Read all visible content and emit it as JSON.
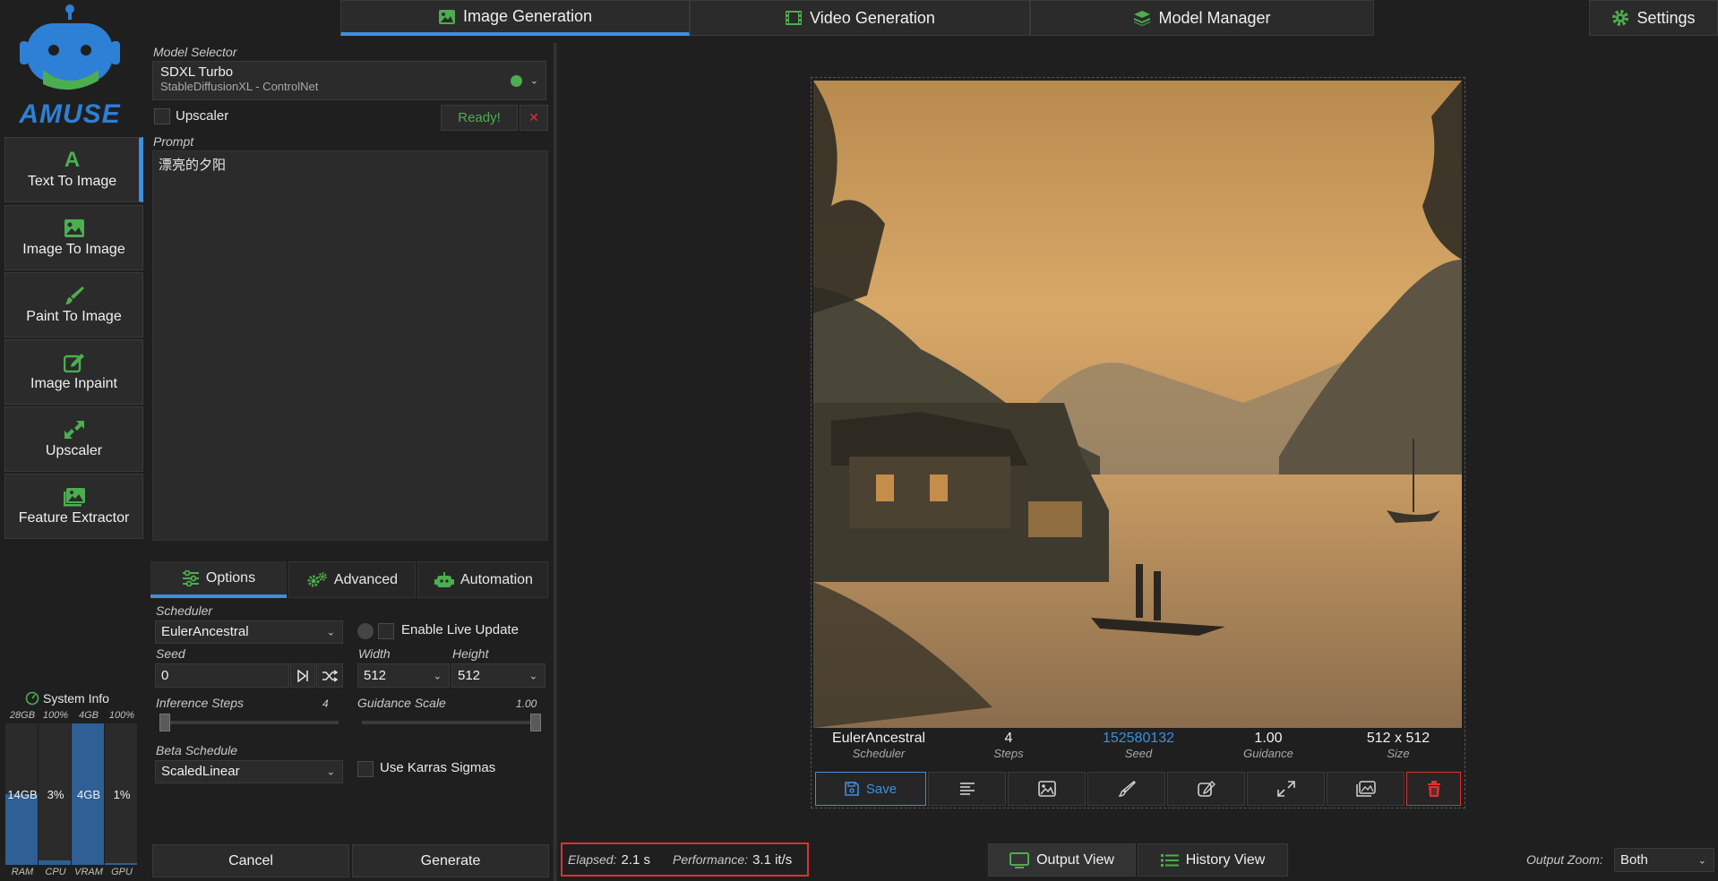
{
  "app": {
    "logo_text": "AMUSE"
  },
  "top_tabs": [
    {
      "label": "Image Generation",
      "icon": "image-icon",
      "active": true
    },
    {
      "label": "Video Generation",
      "icon": "film-icon",
      "active": false
    },
    {
      "label": "Model Manager",
      "icon": "layers-icon",
      "active": false
    }
  ],
  "settings_label": "Settings",
  "sidebar": {
    "items": [
      {
        "label": "Text To Image",
        "icon": "text-a-icon",
        "active": true
      },
      {
        "label": "Image To Image",
        "icon": "image-icon",
        "active": false
      },
      {
        "label": "Paint To Image",
        "icon": "brush-icon",
        "active": false
      },
      {
        "label": "Image Inpaint",
        "icon": "edit-icon",
        "active": false
      },
      {
        "label": "Upscaler",
        "icon": "expand-icon",
        "active": false
      },
      {
        "label": "Feature Extractor",
        "icon": "gallery-icon",
        "active": false
      }
    ],
    "system_info": {
      "title": "System Info",
      "meters": [
        {
          "top": "28GB",
          "mid": "14GB",
          "bottom": "RAM",
          "fill": 0.5
        },
        {
          "top": "100%",
          "mid": "3%",
          "bottom": "CPU",
          "fill": 0.03
        },
        {
          "top": "4GB",
          "mid": "4GB",
          "bottom": "VRAM",
          "fill": 1.0
        },
        {
          "top": "100%",
          "mid": "1%",
          "bottom": "GPU",
          "fill": 0.01
        }
      ]
    }
  },
  "model_selector": {
    "label": "Model Selector",
    "name": "SDXL Turbo",
    "sub": "StableDiffusionXL - ControlNet",
    "status_color": "#4cae4f"
  },
  "upscaler": {
    "label": "Upscaler",
    "ready": "Ready!",
    "close": "✕"
  },
  "prompt": {
    "label": "Prompt",
    "value": "漂亮的夕阳"
  },
  "option_tabs": [
    {
      "label": "Options",
      "active": true
    },
    {
      "label": "Advanced",
      "active": false
    },
    {
      "label": "Automation",
      "active": false
    }
  ],
  "options": {
    "scheduler_label": "Scheduler",
    "scheduler_value": "EulerAncestral",
    "live_update_label": "Enable Live Update",
    "seed_label": "Seed",
    "seed_value": "0",
    "width_label": "Width",
    "width_value": "512",
    "height_label": "Height",
    "height_value": "512",
    "steps_label": "Inference Steps",
    "steps_value": "4",
    "steps_fraction": 0.0,
    "guidance_label": "Guidance Scale",
    "guidance_value": "1.00",
    "guidance_fraction": 1.0,
    "beta_label": "Beta Schedule",
    "beta_value": "ScaledLinear",
    "karras_label": "Use Karras Sigmas"
  },
  "actions": {
    "cancel": "Cancel",
    "generate": "Generate"
  },
  "result": {
    "stats": [
      {
        "value": "EulerAncestral",
        "label": "Scheduler"
      },
      {
        "value": "4",
        "label": "Steps"
      },
      {
        "value": "152580132",
        "label": "Seed",
        "link": true
      },
      {
        "value": "1.00",
        "label": "Guidance"
      },
      {
        "value": "512 x 512",
        "label": "Size"
      }
    ],
    "save_label": "Save"
  },
  "status_bar": {
    "elapsed_label": "Elapsed:",
    "elapsed_value": "2.1 s",
    "performance_label": "Performance:",
    "performance_value": "3.1 it/s",
    "output_view": "Output View",
    "history_view": "History View",
    "zoom_label": "Output Zoom:",
    "zoom_value": "Both"
  },
  "colors": {
    "accent": "#3d8fe0",
    "brand_green": "#4cae4f",
    "danger": "#e03030"
  }
}
